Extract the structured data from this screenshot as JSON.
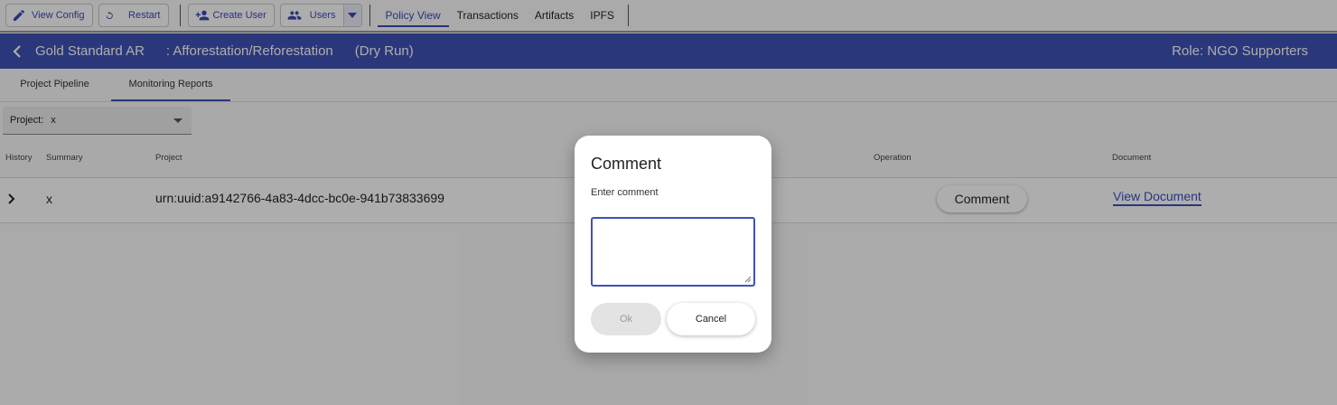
{
  "toolbar": {
    "view_config_label": "View Config",
    "restart_label": "Restart",
    "create_user_label": "Create User",
    "users_label": "Users",
    "tabs": [
      {
        "label": "Policy View",
        "active": true
      },
      {
        "label": "Transactions",
        "active": false
      },
      {
        "label": "Artifacts",
        "active": false
      },
      {
        "label": "IPFS",
        "active": false
      }
    ]
  },
  "header": {
    "title": "Gold Standard AR",
    "subtitle": ": Afforestation/Reforestation",
    "mode": "(Dry Run)",
    "role": "Role: NGO Supporters",
    "color": "#3f51b5"
  },
  "subtabs": [
    {
      "label": "Project Pipeline",
      "active": false
    },
    {
      "label": "Monitoring Reports",
      "active": true
    }
  ],
  "filter": {
    "label": "Project:",
    "value": "x"
  },
  "table": {
    "columns": [
      "History",
      "Summary",
      "Project",
      "Operation",
      "Document"
    ],
    "rows": [
      {
        "summary": "x",
        "project": "urn:uuid:a9142766-4a83-4dcc-bc0e-941b73833699",
        "operation_label": "Comment",
        "document_label": "View Document"
      }
    ]
  },
  "dialog": {
    "title": "Comment",
    "label": "Enter comment",
    "textarea_value": "",
    "ok_label": "Ok",
    "ok_disabled": true,
    "cancel_label": "Cancel"
  },
  "icons": {
    "edit": "pencil-icon",
    "restart": "restart-icon",
    "add_user": "person-add-icon",
    "users": "group-icon",
    "dropdown": "caret-down-icon",
    "back": "chevron-left-icon",
    "expand": "chevron-right-icon"
  }
}
